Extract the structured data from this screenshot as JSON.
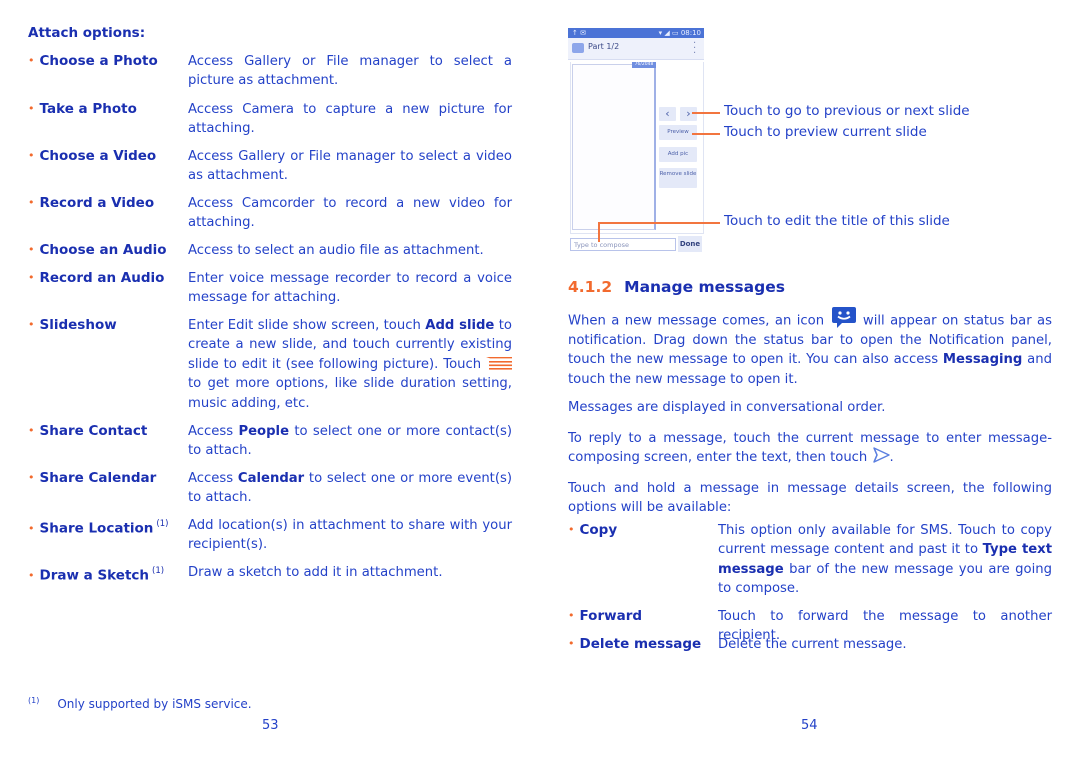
{
  "left_page": {
    "section_head": "Attach options:",
    "options": [
      {
        "term": "Choose a Photo",
        "sup": "",
        "desc": "Access Gallery or File manager to select a picture as attachment."
      },
      {
        "term": "Take a Photo",
        "sup": "",
        "desc": "Access Camera to capture a new picture for attaching."
      },
      {
        "term": "Choose a Video",
        "sup": "",
        "desc": "Access Gallery or File manager to select a video as attachment."
      },
      {
        "term": "Record a Video",
        "sup": "",
        "desc": "Access Camcorder to record a new video for attaching."
      },
      {
        "term": "Choose an Audio",
        "sup": "",
        "desc": "Access to select an audio file as attachment."
      },
      {
        "term": "Record an Audio",
        "sup": "",
        "desc": "Enter voice message recorder to record a voice message for attaching."
      },
      {
        "term": "Slideshow",
        "sup": "",
        "desc_parts": [
          "Enter Edit slide show screen, touch ",
          "Add slide",
          " to create a new slide, and touch currently existing slide to edit it (see following picture). Touch ",
          " to get more options, like slide duration setting, music adding, etc."
        ],
        "icon": "menu-icon"
      },
      {
        "term": "Share Contact",
        "sup": "",
        "desc_parts": [
          "Access ",
          "People",
          " to select one or more contact(s) to attach."
        ]
      },
      {
        "term": "Share Calendar",
        "sup": "",
        "desc_parts": [
          "Access ",
          "Calendar",
          " to select one or more event(s) to attach."
        ]
      },
      {
        "term": "Share Location",
        "sup": "(1)",
        "desc": "Add location(s) in attachment to share with your recipient(s)."
      },
      {
        "term": "Draw a Sketch",
        "sup": "(1)",
        "desc": "Draw a sketch to add it in attachment."
      }
    ],
    "footnote_mark": "(1)",
    "footnote": "Only supported by iSMS service.",
    "page_number": "53"
  },
  "phone": {
    "status_left": "↑ ✉",
    "status_right": "▾ ◢ ▭ 08:10",
    "title": "Part 1/2",
    "counter": "76/2048",
    "prev_label": "‹",
    "next_label": "›",
    "preview_label": "Preview",
    "add_pic_label": "Add pic",
    "remove_slide_label": "Remove slide",
    "input_placeholder": "Type to compose",
    "done_label": "Done"
  },
  "callouts": {
    "prev_next": "Touch to go to previous or next slide",
    "preview": "Touch to preview current slide",
    "edit_title": "Touch to edit the title of this slide"
  },
  "right_page": {
    "section_number": "4.1.2",
    "section_title": "Manage messages",
    "para1_parts": [
      "When a new message comes, an icon ",
      " will appear on status bar as notification. Drag down the status bar to open the Notification panel, touch the new message to open it. You can also access ",
      "Messaging",
      " and touch the new message to open it."
    ],
    "para2": "Messages are displayed in conversational order.",
    "para3_parts": [
      "To reply to a message, touch the current message to enter message-composing screen, enter the text, then touch ",
      "."
    ],
    "para4": "Touch and hold a message in message details screen, the following options will be available:",
    "options": [
      {
        "term": "Copy",
        "desc_parts": [
          "This option only available for SMS. Touch to copy current message content and past it to ",
          "Type text message",
          " bar of the new message you are going to compose."
        ]
      },
      {
        "term": "Forward",
        "desc": "Touch to forward the message to another recipient."
      },
      {
        "term": "Delete message",
        "desc": "Delete the current message."
      }
    ],
    "page_number": "54"
  },
  "colors": {
    "text": "#2442c8",
    "bold_text": "#1a2fb0",
    "accent_orange": "#f26a2e",
    "phone_status_bar": "#4b73d6"
  }
}
